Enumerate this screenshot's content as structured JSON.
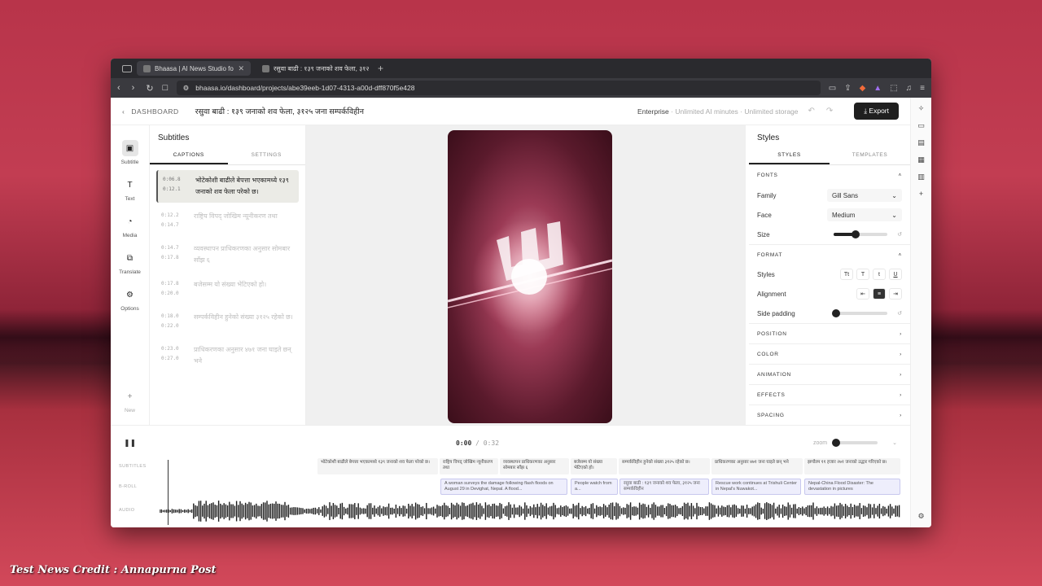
{
  "browser": {
    "tabs": [
      {
        "label": "Bhaasa | AI News Studio fo",
        "active": true
      },
      {
        "label": "रसुवा बाढी : १३९ जनाको शव फेला, ३१२५",
        "active": false
      }
    ],
    "url": "bhaasa.io/dashboard/projects/abe39eeb-1d07-4313-a00d-dff870f5e428"
  },
  "header": {
    "back_label": "DASHBOARD",
    "title": "रसुवा बाढी : १३९ जनाको शव फेला, ३१२५ जना सम्पर्कविहीन",
    "plan": "Enterprise",
    "plan_detail": " · Unlimited AI minutes · Unlimited storage",
    "export_label": "Export"
  },
  "rail": {
    "items": [
      {
        "label": "Subtitle",
        "icon": "subtitle-icon"
      },
      {
        "label": "Text",
        "icon": "text-icon"
      },
      {
        "label": "Media",
        "icon": "media-icon"
      },
      {
        "label": "Translate",
        "icon": "translate-icon"
      },
      {
        "label": "Options",
        "icon": "gear-icon"
      }
    ],
    "new_label": "New"
  },
  "subtitles": {
    "title": "Subtitles",
    "tabs": [
      "CAPTIONS",
      "SETTINGS"
    ],
    "captions": [
      {
        "start": "0:06.8",
        "end": "0:12.1",
        "text": "भोटेकोशी बाढीले बेपत्ता भएकामध्ये १३९ जनाको शव फेला परेको छ।",
        "active": true
      },
      {
        "start": "0:12.2",
        "end": "0:14.7",
        "text": "राष्ट्रिय विपद् जोखिम न्यूनीकरण तथा",
        "active": false
      },
      {
        "start": "0:14.7",
        "end": "0:17.8",
        "text": "व्यवस्थापन प्राधिकरणका अनुसार सोमबार साँझ ६",
        "active": false
      },
      {
        "start": "0:17.8",
        "end": "0:20.0",
        "text": "बजेसम्म यो संख्या भेटिएको हो।",
        "active": false
      },
      {
        "start": "0:18.0",
        "end": "0:22.0",
        "text": "सम्पर्कविहीन हुनेको संख्या ३१२५ रहेको छ।",
        "active": false
      },
      {
        "start": "0:23.0",
        "end": "0:27.0",
        "text": "प्राधिकरणका अनुसार ४७१ जना घाइते छन् भने",
        "active": false
      }
    ]
  },
  "styles": {
    "title": "Styles",
    "tabs": [
      "STYLES",
      "TEMPLATES"
    ],
    "fonts_label": "FONTS",
    "family_label": "Family",
    "family_value": "Gill Sans",
    "face_label": "Face",
    "face_value": "Medium",
    "size_label": "Size",
    "size_value": 0.4,
    "format_label": "FORMAT",
    "styles_label": "Styles",
    "style_buttons": [
      "Tt",
      "T",
      "t",
      "U"
    ],
    "alignment_label": "Alignment",
    "side_padding_label": "Side padding",
    "side_padding_value": 0.05,
    "sections": [
      "POSITION",
      "COLOR",
      "ANIMATION",
      "EFFECTS",
      "SPACING"
    ]
  },
  "timeline": {
    "current": "0:00",
    "separator": "/",
    "total": "0:32",
    "zoom_label": "zoom",
    "zoom_value": 0.05,
    "track_labels": [
      "SUBTITLES",
      "B-ROLL",
      "AUDIO"
    ],
    "subtitle_segments": [
      "भोटेकोशी बाढीले बेपत्ता भएकामध्ये १३९ जनाको शव फेला परेको छ।",
      "राष्ट्रिय विपद् जोखिम न्यूनीकरण तथा",
      "व्यवस्थापन प्राधिकरणका अनुसार सोमबार साँझ ६",
      "बजेसम्म यो संख्या भेटिएको हो।",
      "सम्पर्कविहीन हुनेको संख्या ३१२५ रहेको छ।",
      "प्राधिकरणका अनुसार ४७१ जना घाइते छन् भने",
      "झण्डैरम ११ हजार २७१ जनाको उद्धार गरिएको छ।"
    ],
    "broll_segments": [
      "A woman surveys the damage following flash floods on August 29 in Devighat, Nepal. A flood...",
      "People watch from a...",
      "रसुवा बाढी : १३९ जनाको शव फेला, ३१२५ जना सम्पर्कविहीन",
      "Rescue work continues at Trishuli Center in Nepal's Nuwakot...",
      "Nepal-China Flood Disaster: The devastation in pictures"
    ]
  },
  "overlay": {
    "credit": "Test News Credit : Annapurna Post"
  }
}
